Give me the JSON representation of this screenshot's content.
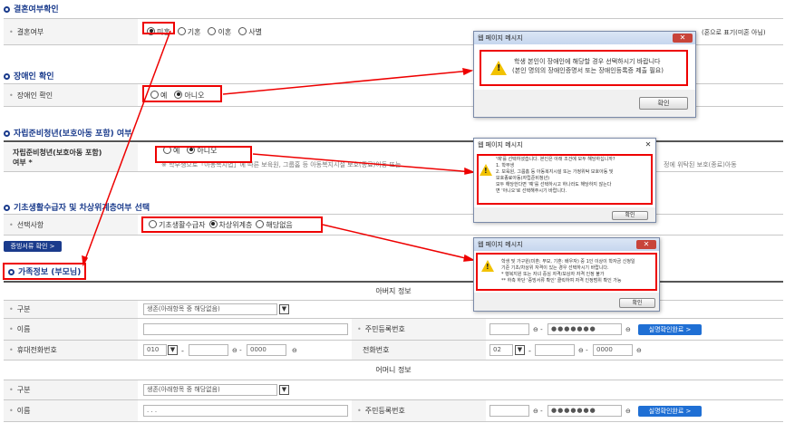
{
  "sections": {
    "marriage": {
      "title": "결혼여부확인",
      "label": "결혼여부",
      "options": [
        "미혼",
        "기혼",
        "이혼",
        "사별"
      ],
      "right_note": "(혼으로 표기(미혼 아님)"
    },
    "disability": {
      "title": "장애인 확인",
      "label": "장애인 확인",
      "options": [
        "예",
        "아니오"
      ]
    },
    "youth": {
      "title": "자립준비청년(보호아동 포함) 여부",
      "label_line1": "자립준비청년(보호아동 포함)",
      "label_line2": "여부 *",
      "options": [
        "예",
        "아니오"
      ],
      "note": "※ 학부생으로「아동복지법」에 따른 보육원, 그룹홈 등 아동복지시설 보호(종료)아동 또는",
      "note_right": "정에 위탁된 보호(종료)아동"
    },
    "basic_living": {
      "title": "기초생활수급자 및 차상위계층여부 선택",
      "label": "선택사항",
      "options": [
        "기초생활수급자",
        "차상위계층",
        "해당없음"
      ],
      "proof_button": "증빙서류 확인 >"
    },
    "family": {
      "title": "가족정보 (부모님)",
      "father_header": "아버지 정보",
      "mother_header": "어머니 정보",
      "rows": {
        "type_label": "구분",
        "type_value": "생존(아래항목 중 해당없음)",
        "name_label": "이름",
        "rrn_label": "주민등록번호",
        "rrn_masked": "●●●●●●●",
        "verify_button": "실명확인완료 >",
        "phone_label": "휴대전화번호",
        "phone_prefix": "010",
        "phone_mid": "",
        "phone_last_placeholder": "0000",
        "tel_label": "전화번호",
        "tel_prefix": "02",
        "tel_last_placeholder": "0000",
        "mother_name_placeholder": ". . ."
      }
    }
  },
  "dialogs": {
    "d1": {
      "title": "웹 페이지 메시지",
      "line1": "학생 본인이 장애인에 해당할 경우 선택하시기 바랍니다",
      "line2": "(본인 명의의 장애인증명서 또는 장애인등록증 제출 필요)",
      "ok": "확인"
    },
    "d2": {
      "title": "웹 페이지 메시지",
      "lines": [
        "'예'를 선택하셨습니다. 본인은 아래 조건에 모두 해당하십니까?",
        "1. 학부생",
        "2. 보육원, 그룹홈 등 아동복지시설 또는 가정위탁 보호아동 및",
        "보호종료아동(자립준비청년)",
        "모두 해당한다면 '예'를 선택하시고 하나라도 해당하지 않는다",
        "면 '아니오'로 선택해주시기 바랍니다."
      ],
      "ok": "확인"
    },
    "d3": {
      "title": "웹 페이지 메시지",
      "lines": [
        "학생 및 가구원(미혼: 부모, 기혼: 배우자) 중 1인 이상이 학자금 신청일",
        "기준 기초/차상위 자격이 있는 경우 선택하시기 바랍니다.",
        "* 행복지원 또는 자녀 중심 자격/보상자 자격 인정 불가",
        "** 하측 하단 '증빙서류 확인' 클릭하여 자격 인정범위 확인 가능"
      ],
      "ok": "확인"
    }
  },
  "colors": {
    "accent": "#1a3b8c",
    "highlight": "#e00000",
    "verify": "#1f6fd4"
  }
}
